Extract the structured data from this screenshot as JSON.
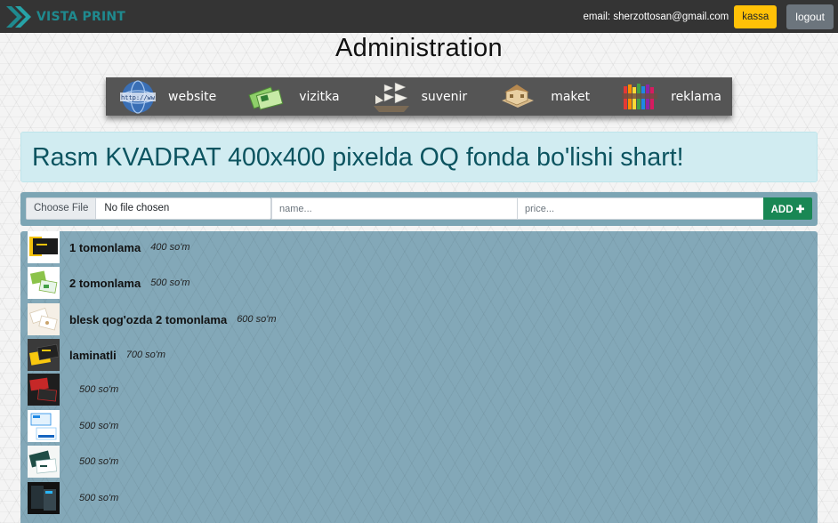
{
  "header": {
    "brand": "VISTA PRINT",
    "email": "email: sherzottosan@gmail.com",
    "kassa_label": "kassa",
    "logout_label": "logout",
    "brand_color": "#1f8a8f"
  },
  "page_title": "Administration",
  "categories": [
    {
      "label": "website",
      "icon": "globe-icon"
    },
    {
      "label": "vizitka",
      "icon": "business-cards-icon"
    },
    {
      "label": "suvenir",
      "icon": "ship-icon"
    },
    {
      "label": "maket",
      "icon": "house-model-icon"
    },
    {
      "label": "reklama",
      "icon": "colorful-sign-icon"
    }
  ],
  "notice": "Rasm KVADRAT 400x400 pixelda OQ fonda bo'lishi shart!",
  "upload": {
    "file_button": "Choose File",
    "file_status": "No file chosen",
    "name_placeholder": "name...",
    "price_placeholder": "price...",
    "add_label": "ADD"
  },
  "products": [
    {
      "name": "1 tomonlama",
      "price": "400 so'm"
    },
    {
      "name": "2 tomonlama",
      "price": "500 so'm"
    },
    {
      "name": "blesk qog'ozda 2 tomonlama",
      "price": "600 so'm"
    },
    {
      "name": "laminatli",
      "price": "700 so'm"
    },
    {
      "name": "",
      "price": "500 so'm"
    },
    {
      "name": "",
      "price": "500 so'm"
    },
    {
      "name": "",
      "price": "500 so'm"
    },
    {
      "name": "",
      "price": "500 so'm"
    }
  ],
  "colors": {
    "navbar": "#343434",
    "kassa": "#ffc107",
    "logout": "#6c757d",
    "alert_bg": "#d1ecf1",
    "alert_text": "#0c5460",
    "add_button": "#198754",
    "panel": "#83a8b8"
  }
}
